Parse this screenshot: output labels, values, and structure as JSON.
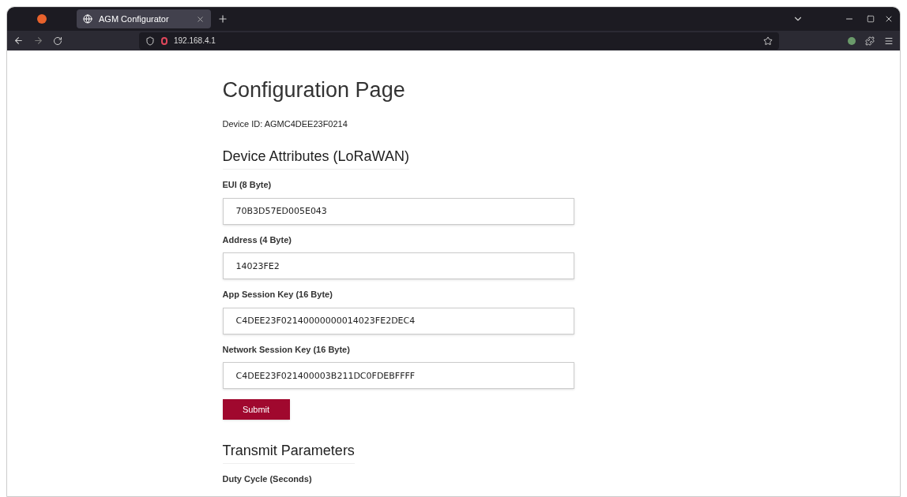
{
  "browser": {
    "tabs": [
      {
        "title": "AGM Configurator",
        "selected": true
      }
    ],
    "url": "192.168.4.1"
  },
  "page": {
    "title": "Configuration Page",
    "device_id": "Device ID: AGMC4DEE23F0214",
    "sections": [
      {
        "heading": "Device Attributes (LoRaWAN)",
        "fields": [
          {
            "label": "EUI (8 Byte)",
            "value": "70B3D57ED005E043"
          },
          {
            "label": "Address (4 Byte)",
            "value": "14023FE2"
          },
          {
            "label": "App Session Key (16 Byte)",
            "value": "C4DEE23F02140000000014023FE2DEC4"
          },
          {
            "label": "Network Session Key (16 Byte)",
            "value": "C4DEE23F021400003B211DC0FDEBFFFF"
          }
        ],
        "button": "Submit"
      },
      {
        "heading": "Transmit Parameters",
        "fields": [
          {
            "label": "Duty Cycle (Seconds)"
          }
        ]
      }
    ]
  }
}
